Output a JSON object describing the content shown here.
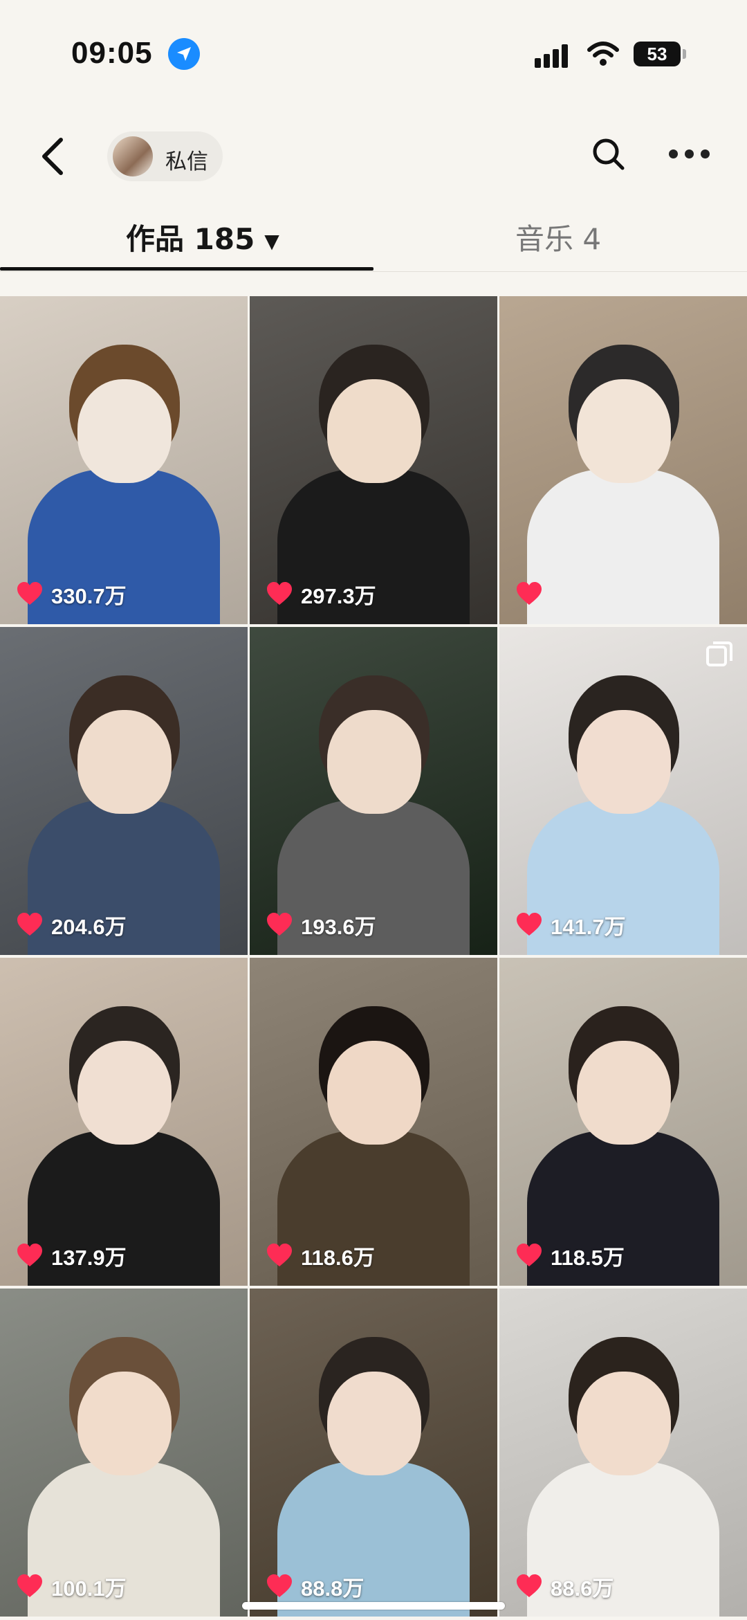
{
  "status_bar": {
    "time": "09:05",
    "battery": "53"
  },
  "nav": {
    "message_label": "私信"
  },
  "tabs": [
    {
      "label": "作品 185",
      "caret": "▼"
    },
    {
      "label": "音乐 4"
    }
  ],
  "videos": [
    {
      "likes": "330.7万"
    },
    {
      "likes": "297.3万"
    },
    {
      "likes": ""
    },
    {
      "likes": "204.6万"
    },
    {
      "likes": "193.6万"
    },
    {
      "likes": "141.7万"
    },
    {
      "likes": "137.9万"
    },
    {
      "likes": "118.6万"
    },
    {
      "likes": "118.5万"
    },
    {
      "likes": "100.1万"
    },
    {
      "likes": "88.8万"
    },
    {
      "likes": "88.6万"
    }
  ],
  "colors": {
    "heart": "#fe2c55",
    "accent": "#111111",
    "location": "#1a8cff"
  },
  "icons": [
    "location-arrow-icon",
    "signal-icon",
    "wifi-icon",
    "battery-icon",
    "back-arrow-icon",
    "search-icon",
    "more-icon",
    "heart-icon",
    "multi-image-icon"
  ]
}
